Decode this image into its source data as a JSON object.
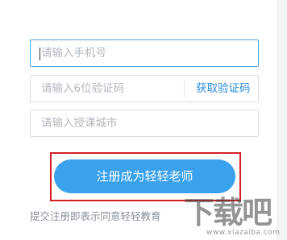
{
  "form": {
    "phone_placeholder": "请输入手机号",
    "code_placeholder": "请输入6位验证码",
    "get_code_label": "获取验证码",
    "city_placeholder": "请输入授课城市",
    "submit_label": "注册成为轻轻老师",
    "agreement_text": "提交注册即表示同意轻轻教育"
  },
  "watermark": {
    "text": "下载吧",
    "url": "www.xiazaiba.com"
  },
  "colors": {
    "accent": "#3aa1ec",
    "link": "#2d8bd7",
    "highlight_border": "#d51f24",
    "focused_border": "#4ba3e3"
  }
}
